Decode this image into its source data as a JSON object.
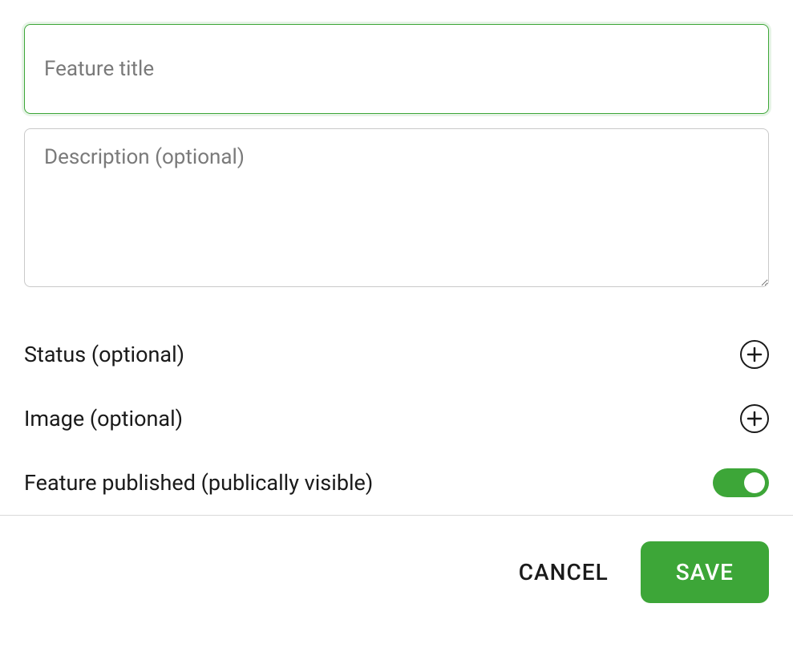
{
  "form": {
    "title_placeholder": "Feature title",
    "title_value": "",
    "description_placeholder": "Description (optional)",
    "description_value": "",
    "status_label": "Status (optional)",
    "image_label": "Image (optional)",
    "published_label": "Feature published (publically visible)",
    "published_value": true
  },
  "footer": {
    "cancel_label": "CANCEL",
    "save_label": "SAVE"
  },
  "colors": {
    "accent": "#3da638"
  }
}
